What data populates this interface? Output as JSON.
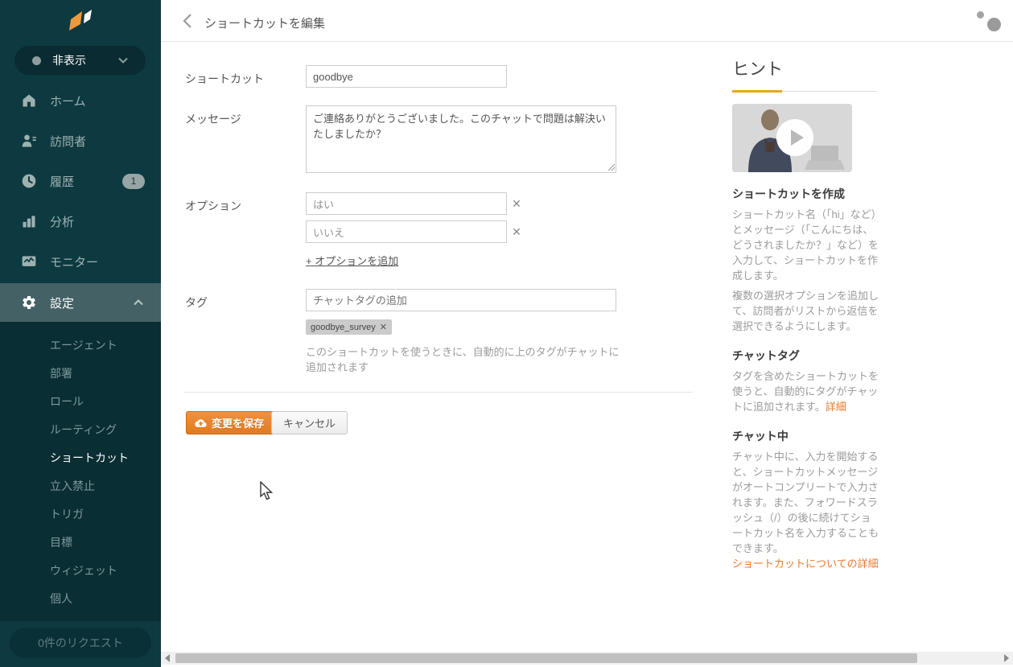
{
  "icons": {
    "close": "✕",
    "plus_note": "+"
  },
  "sidebar": {
    "status": {
      "label": "非表示"
    },
    "nav": [
      {
        "label": "ホーム",
        "icon": "home-icon"
      },
      {
        "label": "訪問者",
        "icon": "visitors-icon"
      },
      {
        "label": "履歴",
        "icon": "history-icon",
        "badge": "1"
      },
      {
        "label": "分析",
        "icon": "analytics-icon"
      },
      {
        "label": "モニター",
        "icon": "monitor-icon"
      },
      {
        "label": "設定",
        "icon": "settings-icon"
      }
    ],
    "submenu": [
      "エージェント",
      "部署",
      "ロール",
      "ルーティング",
      "ショートカット",
      "立入禁止",
      "トリガ",
      "目標",
      "ウィジェット",
      "個人"
    ],
    "requests_button": "0件のリクエスト"
  },
  "header": {
    "title": "ショートカットを編集"
  },
  "form": {
    "shortcut_label": "ショートカット",
    "shortcut_value": "goodbye",
    "message_label": "メッセージ",
    "message_value": "ご連絡ありがとうございました。このチャットで問題は解決いたしましたか？",
    "options_label": "オプション",
    "option_1": "はい",
    "option_2": "いいえ",
    "add_option_label": "+ オプションを追加",
    "tags_label": "タグ",
    "tags_placeholder": "チャットタグの追加",
    "tag_chip": "goodbye_survey",
    "tags_help": "このショートカットを使うときに、自動的に上のタグがチャットに追加されます",
    "save_label": "変更を保存",
    "cancel_label": "キャンセル"
  },
  "hints": {
    "title": "ヒント",
    "section1": {
      "heading": "ショートカットを作成",
      "p1": "ショートカット名（「hi」など）とメッセージ（「こんにちは、どうされましたか？」など）を入力して、ショートカットを作成します。",
      "p2": "複数の選択オプションを追加して、訪問者がリストから返信を選択できるようにします。"
    },
    "section2": {
      "heading": "チャットタグ",
      "body": "タグを含めたショートカットを使うと、自動的にタグがチャットに追加されます。",
      "link": "詳細"
    },
    "section3": {
      "heading": "チャット中",
      "body": "チャット中に、入力を開始すると、ショートカットメッセージがオートコンプリートで入力されます。また、フォワードスラッシュ（/）の後に続けてショートカット名を入力することもできます。",
      "link": "ショートカットについての詳細"
    }
  },
  "colors": {
    "sidebar_bg": "#0d3a40",
    "submenu_bg": "#092e33",
    "active_nav_bg": "#446266",
    "accent_orange": "#e8832c",
    "hints_rule_orange": "#e9a713",
    "link_orange": "#e87a2e"
  }
}
